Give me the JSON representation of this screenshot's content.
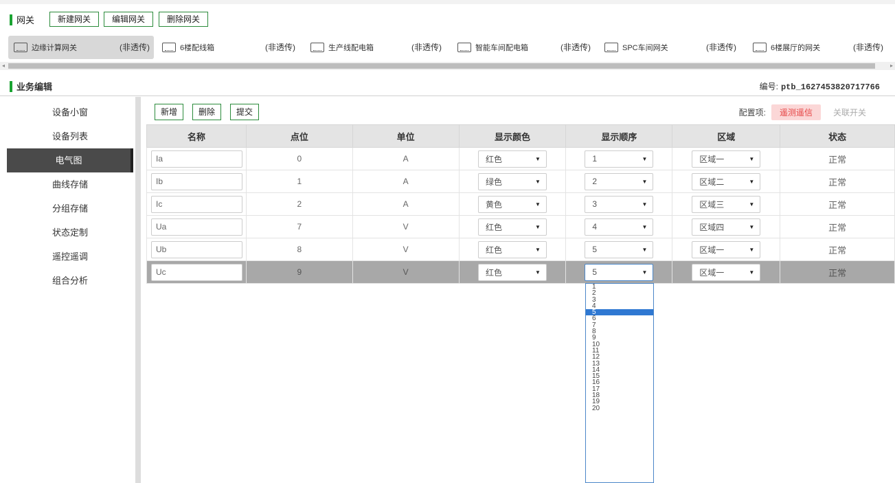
{
  "gateway": {
    "title": "网关",
    "new_label": "新建网关",
    "edit_label": "编辑网关",
    "delete_label": "删除网关"
  },
  "gateways": [
    {
      "name": "边缘计算网关",
      "tag": "(非透传)"
    },
    {
      "name": "6楼配线箱",
      "tag": "(非透传)"
    },
    {
      "name": "生产线配电箱",
      "tag": "(非透传)"
    },
    {
      "name": "智能车间配电箱",
      "tag": "(非透传)"
    },
    {
      "name": "SPC车间网关",
      "tag": "(非透传)"
    },
    {
      "name": "6楼展厅的网关",
      "tag": "(非透传)"
    }
  ],
  "section": {
    "title": "业务编辑",
    "code_label": "编号:",
    "code_value": "ptb_1627453820717766"
  },
  "sidebar": {
    "items": [
      {
        "label": "设备小窗"
      },
      {
        "label": "设备列表"
      },
      {
        "label": "电气图"
      },
      {
        "label": "曲线存储"
      },
      {
        "label": "分组存储"
      },
      {
        "label": "状态定制"
      },
      {
        "label": "遥控遥调"
      },
      {
        "label": "组合分析"
      }
    ]
  },
  "actions": {
    "add_label": "新增",
    "delete_label": "删除",
    "submit_label": "提交"
  },
  "config": {
    "label": "配置项:",
    "active_tab": "遥测遥信",
    "inactive_tab": "关联开关"
  },
  "table": {
    "headers": [
      "名称",
      "点位",
      "单位",
      "显示颜色",
      "显示顺序",
      "区域",
      "状态"
    ],
    "rows": [
      {
        "name": "Ia",
        "point": "0",
        "unit": "A",
        "color": "红色",
        "order": "1",
        "region": "区域一",
        "status": "正常"
      },
      {
        "name": "Ib",
        "point": "1",
        "unit": "A",
        "color": "绿色",
        "order": "2",
        "region": "区域二",
        "status": "正常"
      },
      {
        "name": "Ic",
        "point": "2",
        "unit": "A",
        "color": "黄色",
        "order": "3",
        "region": "区域三",
        "status": "正常"
      },
      {
        "name": "Ua",
        "point": "7",
        "unit": "V",
        "color": "红色",
        "order": "4",
        "region": "区域四",
        "status": "正常"
      },
      {
        "name": "Ub",
        "point": "8",
        "unit": "V",
        "color": "红色",
        "order": "5",
        "region": "区域一",
        "status": "正常"
      },
      {
        "name": "Uc",
        "point": "9",
        "unit": "V",
        "color": "红色",
        "order": "5",
        "region": "区域一",
        "status": "正常"
      }
    ]
  },
  "order_dropdown": {
    "highlighted": "5",
    "options": [
      "1",
      "2",
      "3",
      "4",
      "5",
      "6",
      "7",
      "8",
      "9",
      "10",
      "11",
      "12",
      "13",
      "14",
      "15",
      "16",
      "17",
      "18",
      "19",
      "20"
    ]
  }
}
